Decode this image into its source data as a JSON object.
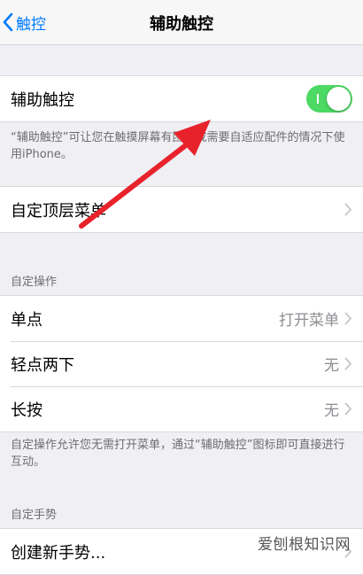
{
  "nav": {
    "back_label": "触控",
    "title": "辅助触控"
  },
  "assistive": {
    "label": "辅助触控",
    "toggle_on": true,
    "footnote": "“辅助触控”可让您在触摸屏幕有困难或需要自适应配件的情况下使用iPhone。"
  },
  "top_menu": {
    "label": "自定顶层菜单"
  },
  "custom_actions": {
    "header": "自定操作",
    "items": [
      {
        "label": "单点",
        "value": "打开菜单"
      },
      {
        "label": "轻点两下",
        "value": "无"
      },
      {
        "label": "长按",
        "value": "无"
      }
    ],
    "footnote": "自定操作允许您无需打开菜单，通过“辅助触控”图标即可直接进行互动。"
  },
  "custom_gestures": {
    "header": "自定手势",
    "items": [
      {
        "label": "创建新手势..."
      }
    ]
  },
  "watermark": "爱刨根知识网",
  "colors": {
    "accent": "#007aff",
    "toggle_on": "#4cd964",
    "annotation_arrow": "#e8222b",
    "background": "#efeff4"
  }
}
